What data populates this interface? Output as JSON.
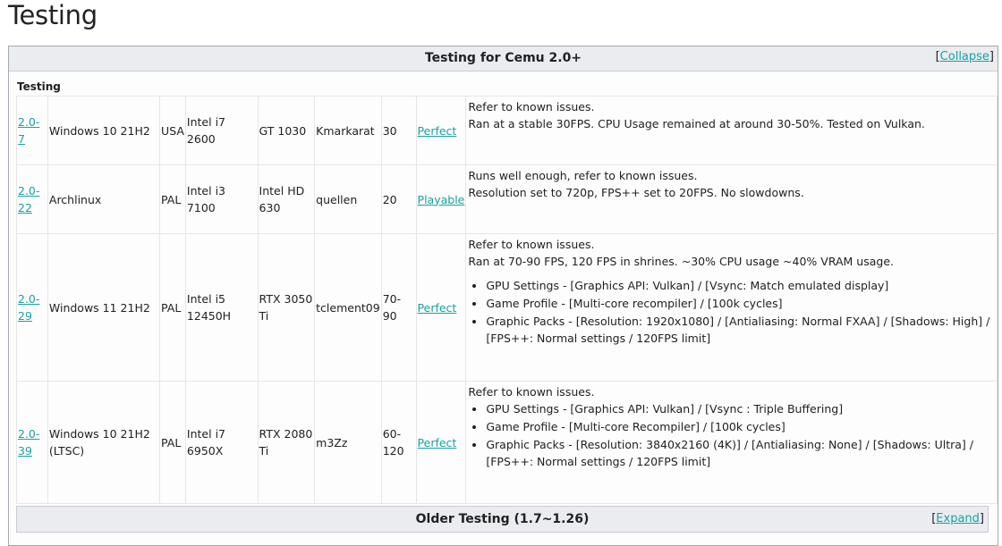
{
  "page": {
    "heading": "Testing"
  },
  "navbox": {
    "title": "Testing for Cemu 2.0+",
    "toggle_open": "[",
    "toggle_label": "Collapse",
    "toggle_close": "]",
    "group_label": "Testing"
  },
  "rows": [
    {
      "version": "2.0-7",
      "os": "Windows 10 21H2",
      "region": "USA",
      "cpu": "Intel i7 2600",
      "gpu": "GT 1030",
      "tester": "Kmarkarat",
      "fps": "30",
      "rating": "Perfect",
      "notes": [
        "Refer to known issues.",
        "Ran at a stable 30FPS. CPU Usage remained at around 30-50%. Tested on Vulkan."
      ],
      "bullets": []
    },
    {
      "version": "2.0-22",
      "os": "Archlinux",
      "region": "PAL",
      "cpu": "Intel i3 7100",
      "gpu": "Intel HD 630",
      "tester": "quellen",
      "fps": "20",
      "rating": "Playable",
      "notes": [
        "Runs well enough, refer to known issues.",
        "Resolution set to 720p, FPS++ set to 20FPS. No slowdowns."
      ],
      "bullets": []
    },
    {
      "version": "2.0-29",
      "os": "Windows 11 21H2",
      "region": "PAL",
      "cpu": "Intel i5 12450H",
      "gpu": "RTX 3050 Ti",
      "tester": "tclement09",
      "fps": "70-90",
      "rating": "Perfect",
      "notes": [
        "Refer to known issues.",
        "Ran at 70-90 FPS, 120 FPS in shrines. ~30% CPU usage ~40% VRAM usage."
      ],
      "bullets": [
        "GPU Settings - [Graphics API: Vulkan] / [Vsync: Match emulated display]",
        "Game Profile - [Multi-core recompiler] / [100k cycles]",
        "Graphic Packs - [Resolution: 1920x1080] / [Antialiasing: Normal FXAA] / [Shadows: High] / [FPS++: Normal settings / 120FPS limit]"
      ]
    },
    {
      "version": "2.0-39",
      "os": "Windows 10 21H2 (LTSC)",
      "region": "PAL",
      "cpu": "Intel i7 6950X",
      "gpu": "RTX 2080 Ti",
      "tester": "m3Zz",
      "fps": "60-120",
      "rating": "Perfect",
      "notes": [
        "Refer to known issues."
      ],
      "bullets": [
        "GPU Settings - [Graphics API: Vulkan] / [Vsync : Triple Buffering]",
        "Game Profile - [Multi-core Recompiler] / [100k cycles]",
        "Graphic Packs - [Resolution: 3840x2160 (4K)] / [Antialiasing: None] / [Shadows: Ultra] / [FPS++: Normal settings / 120FPS limit]"
      ]
    }
  ],
  "older": {
    "title": "Older Testing (1.7~1.26)",
    "toggle_open": "[",
    "toggle_label": "Expand",
    "toggle_close": "]"
  }
}
